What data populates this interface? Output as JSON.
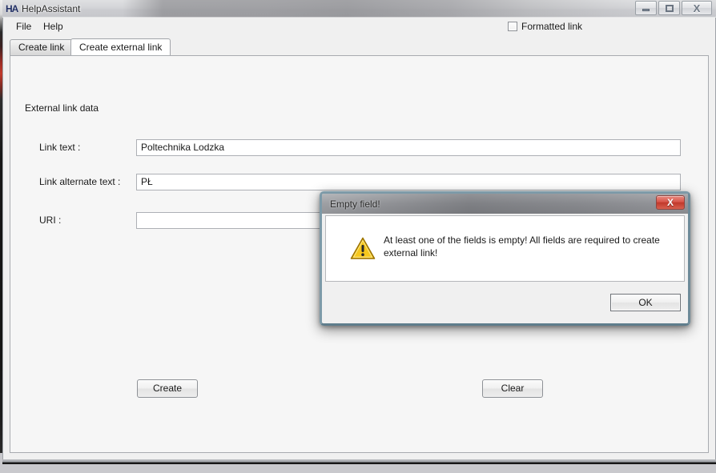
{
  "window": {
    "title": "HelpAssistant",
    "icon": "HA",
    "controls": {
      "minimize": "minimize-button",
      "maximize": "maximize-button",
      "close": "X"
    }
  },
  "menu": {
    "items": [
      {
        "label": "File"
      },
      {
        "label": "Help"
      }
    ]
  },
  "toolbar": {
    "formatted_link_label": "Formatted link",
    "formatted_link_checked": false
  },
  "tabs": [
    {
      "label": "Create link",
      "active": false
    },
    {
      "label": "Create external link",
      "active": true
    }
  ],
  "form": {
    "heading": "External link data",
    "fields": [
      {
        "label": "Link text :",
        "value": "Poltechnika Lodzka",
        "placeholder": ""
      },
      {
        "label": "Link alternate text :",
        "value": "PŁ",
        "placeholder": ""
      },
      {
        "label": "URI :",
        "value": "",
        "placeholder": ""
      }
    ],
    "buttons": {
      "create": "Create",
      "clear": "Clear"
    }
  },
  "dialog": {
    "title": "Empty field!",
    "close_glyph": "X",
    "icon": "warning-triangle",
    "message": "At least one of the fields is empty! All fields are required to create external link!",
    "ok_label": "OK"
  },
  "colors": {
    "warning_yellow": "#f5c518",
    "warning_border": "#c08a00",
    "close_red": "#c0392b",
    "accent_blue": "#1f2d63",
    "panel_bg": "#f6f6f6",
    "window_bg": "#f0f0f0"
  }
}
